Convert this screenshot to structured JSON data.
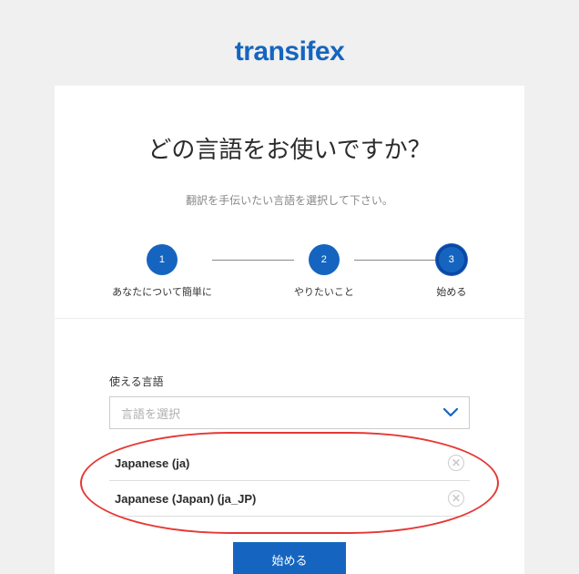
{
  "logo": "transifex",
  "title": "どの言語をお使いですか？",
  "subtitle": "翻訳を手伝いたい言語を選択して下さい。",
  "stepper": {
    "steps": [
      {
        "num": "1",
        "label": "あなたについて簡単に"
      },
      {
        "num": "2",
        "label": "やりたいこと"
      },
      {
        "num": "3",
        "label": "始める"
      }
    ]
  },
  "form": {
    "field_label": "使える言語",
    "select_placeholder": "言語を選択",
    "selected": [
      {
        "label": "Japanese (ja)"
      },
      {
        "label": "Japanese (Japan) (ja_JP)"
      }
    ],
    "submit": "始める"
  }
}
